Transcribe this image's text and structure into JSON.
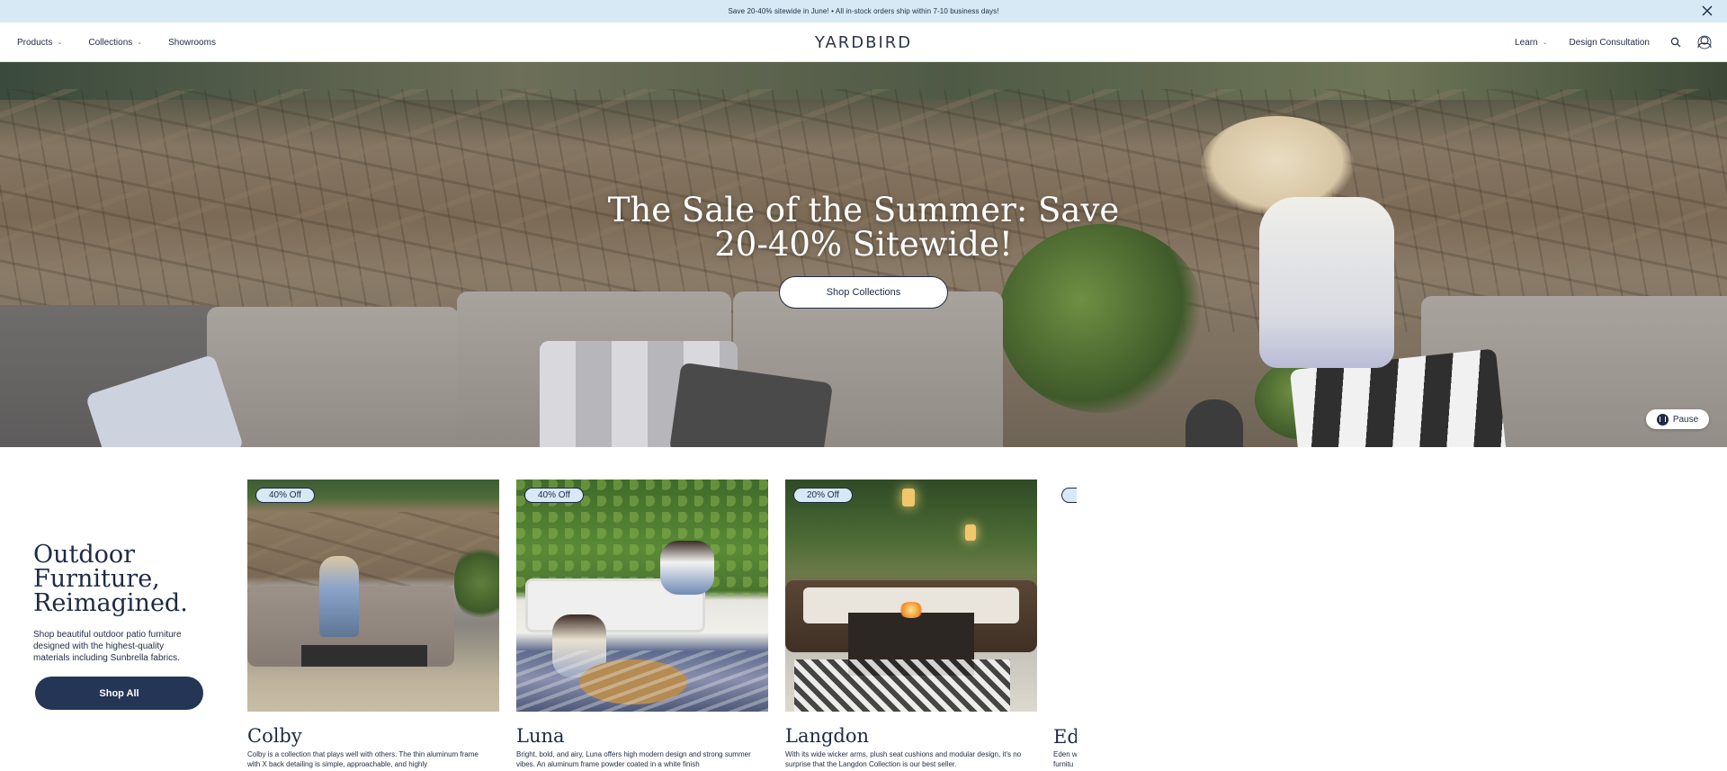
{
  "announcement": {
    "text": "Save 20-40% sitewide in June! • All in-stock orders ship within 7-10 business days!"
  },
  "header": {
    "nav_left": [
      {
        "label": "Products",
        "has_dropdown": true
      },
      {
        "label": "Collections",
        "has_dropdown": true
      },
      {
        "label": "Showrooms",
        "has_dropdown": false
      }
    ],
    "logo": "YARDBIRD",
    "nav_right": {
      "learn": "Learn",
      "consultation": "Design Consultation"
    },
    "icons": [
      "search-icon",
      "account-icon"
    ]
  },
  "hero": {
    "title_line1": "The Sale of the Summer: Save",
    "title_line2": "20-40% Sitewide!",
    "cta": "Shop Collections",
    "pause_label": "Pause"
  },
  "intro": {
    "title_line1": "Outdoor",
    "title_line2": "Furniture,",
    "title_line3": "Reimagined.",
    "description": "Shop beautiful outdoor patio furniture designed with the highest-quality materials including Sunbrella fabrics.",
    "cta": "Shop All"
  },
  "collections": [
    {
      "badge": "40% Off",
      "title": "Colby",
      "description": "Colby is a collection that plays well with others. The thin aluminum frame with X back detailing is simple, approachable, and highly"
    },
    {
      "badge": "40% Off",
      "title": "Luna",
      "description": "Bright, bold, and airy, Luna offers high modern design and strong summer vibes. An aluminum frame powder coated in a white finish"
    },
    {
      "badge": "20% Off",
      "title": "Langdon",
      "description": "With its wide wicker arms, plush seat cushions and modular design, it's no surprise that the Langdon Collection is our best seller."
    }
  ],
  "peek_card": {
    "title": "Ed",
    "description_line1": "Eden w",
    "description_line2": "furnitu"
  },
  "colors": {
    "announcement_bg": "#d7e9f4",
    "navy": "#1f2a44",
    "button_navy": "#253556"
  }
}
